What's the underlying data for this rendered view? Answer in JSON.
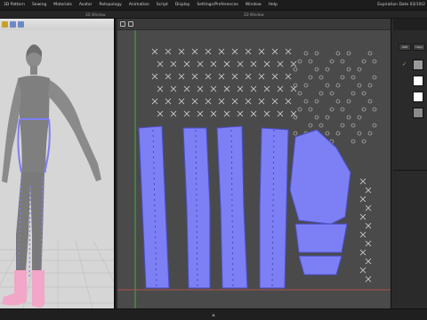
{
  "menubar": {
    "items": [
      "3D Pattern",
      "Sewing",
      "Materials",
      "Avatar",
      "Retopology",
      "Animation",
      "Script",
      "Display",
      "Settings/Preferences",
      "Window",
      "Help"
    ],
    "expiration": "Expiration Date 03/19/2"
  },
  "tabs": {
    "win3d": "3D Window",
    "win2d": "2D Window"
  },
  "panel": {
    "add_label": "Add",
    "copy_label": "Copy"
  },
  "colors": {
    "fabric": "#7d7ff4",
    "fabric_edge": "#4b4fc8",
    "boots": "#f2a6c8",
    "avatar": "#8c8c8c",
    "accent": "#f0a020"
  },
  "icons": {
    "status": "chevron-up-icon",
    "check": "checkmark-icon"
  }
}
